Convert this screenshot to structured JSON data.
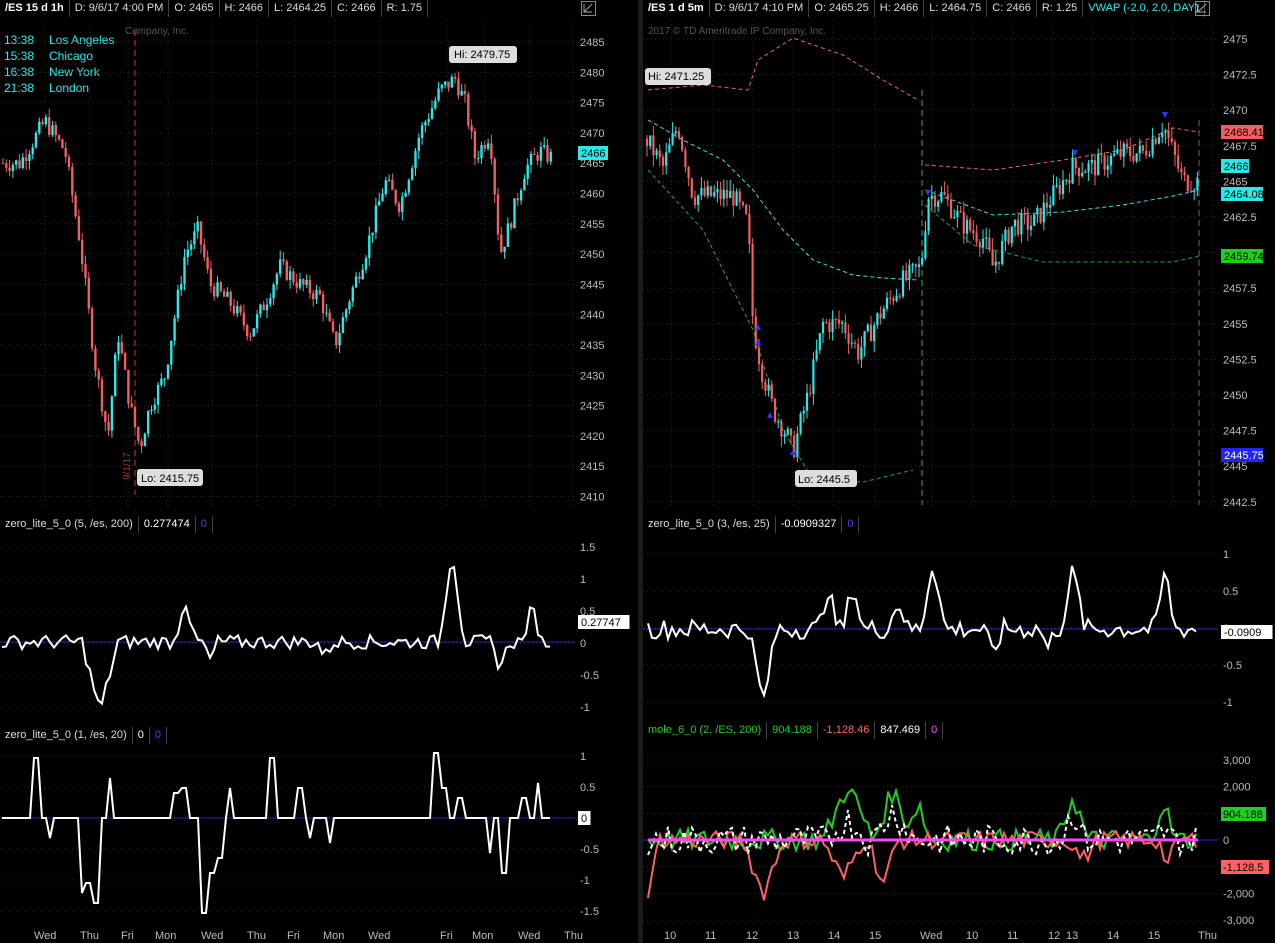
{
  "left": {
    "header": {
      "symbol": "/ES 15 d 1h",
      "date": "D: 9/6/17 4:00 PM",
      "open": "O: 2465",
      "high": "H: 2466",
      "low": "L: 2464.25",
      "close": "C: 2466",
      "range": "R: 1.75"
    },
    "copyright_partial": "Company, Inc.",
    "timezones": [
      {
        "time": "13:38",
        "city": "Los Angeles"
      },
      {
        "time": "15:38",
        "city": "Chicago"
      },
      {
        "time": "16:38",
        "city": "New York"
      },
      {
        "time": "21:38",
        "city": "London"
      }
    ],
    "hi_label": "Hi: 2479.75",
    "lo_label": "Lo: 2415.75",
    "last_badge": "2466",
    "price_ticks": [
      "2485",
      "2480",
      "2475",
      "2470",
      "2465",
      "2460",
      "2455",
      "2450",
      "2445",
      "2440",
      "2435",
      "2430",
      "2425",
      "2420",
      "2415",
      "2410"
    ],
    "study1": {
      "name": "zero_lite_5_0 (5, /es, 200)",
      "value": "0.277474",
      "zero": "0",
      "badge": "0.27747",
      "ticks": [
        "1.5",
        "1",
        "0.5",
        "0",
        "-0.5",
        "-1"
      ]
    },
    "study2": {
      "name": "zero_lite_5_0 (1, /es, 20)",
      "value": "0",
      "zero": "0",
      "badge": "0",
      "ticks": [
        "1",
        "0.5",
        "0",
        "-0.5",
        "-1",
        "-1.5"
      ]
    },
    "x_labels": [
      "Wed",
      "Thu",
      "Fri",
      "Mon",
      "Wed",
      "Thu",
      "Fri",
      "Mon",
      "Wed",
      "Fri",
      "Mon",
      "Wed",
      "Thu"
    ],
    "vert_marker_text": "9/1/17"
  },
  "right": {
    "header": {
      "symbol": "/ES 1 d 5m",
      "date": "D: 9/6/17 4:10 PM",
      "open": "O: 2465.25",
      "high": "H: 2466",
      "low": "L: 2464.75",
      "close": "C: 2466",
      "range": "R: 1.25",
      "vwap": "VWAP (-2.0, 2.0, DAY)"
    },
    "copyright": "2017 © TD Ameritrade IP Company, Inc.",
    "hi_label": "Hi: 2471.25",
    "lo_label": "Lo: 2445.5",
    "badges": {
      "upper": "2468.41",
      "last": "2466",
      "vwap": "2464.08",
      "lower": "2459.74",
      "low": "2445.75"
    },
    "price_ticks": [
      "2475",
      "2472.5",
      "2470",
      "2467.5",
      "2465",
      "2462.5",
      "2460",
      "2457.5",
      "2455",
      "2452.5",
      "2450",
      "2447.5",
      "2445",
      "2442.5"
    ],
    "study1": {
      "name": "zero_lite_5_0 (3, /es, 25)",
      "value": "-0.0909327",
      "zero": "0",
      "badge": "-0.0909",
      "ticks": [
        "1",
        "0.5",
        "0",
        "-0.5",
        "-1"
      ]
    },
    "study2": {
      "name": "mole_6_0 (2, /ES, 200)",
      "v1": "904.188",
      "v2": "-1,128.46",
      "v3": "847.469",
      "v4": "0",
      "badge_up": "904.188",
      "badge_dn": "-1,128.5",
      "ticks": [
        "3,000",
        "2,000",
        "1,000",
        "0",
        "-1,000",
        "-2,000",
        "-3,000"
      ]
    },
    "x_labels": [
      "10",
      "11",
      "12",
      "13",
      "14",
      "15",
      "Wed",
      "10",
      "11",
      "12",
      "13",
      "14",
      "15",
      "Thu"
    ]
  },
  "colors": {
    "up": "#2ee6e6",
    "down": "#f06060",
    "zero_line": "#2222cc",
    "green": "#22cc22",
    "red": "#ff6060",
    "magenta": "#ff44ff"
  }
}
